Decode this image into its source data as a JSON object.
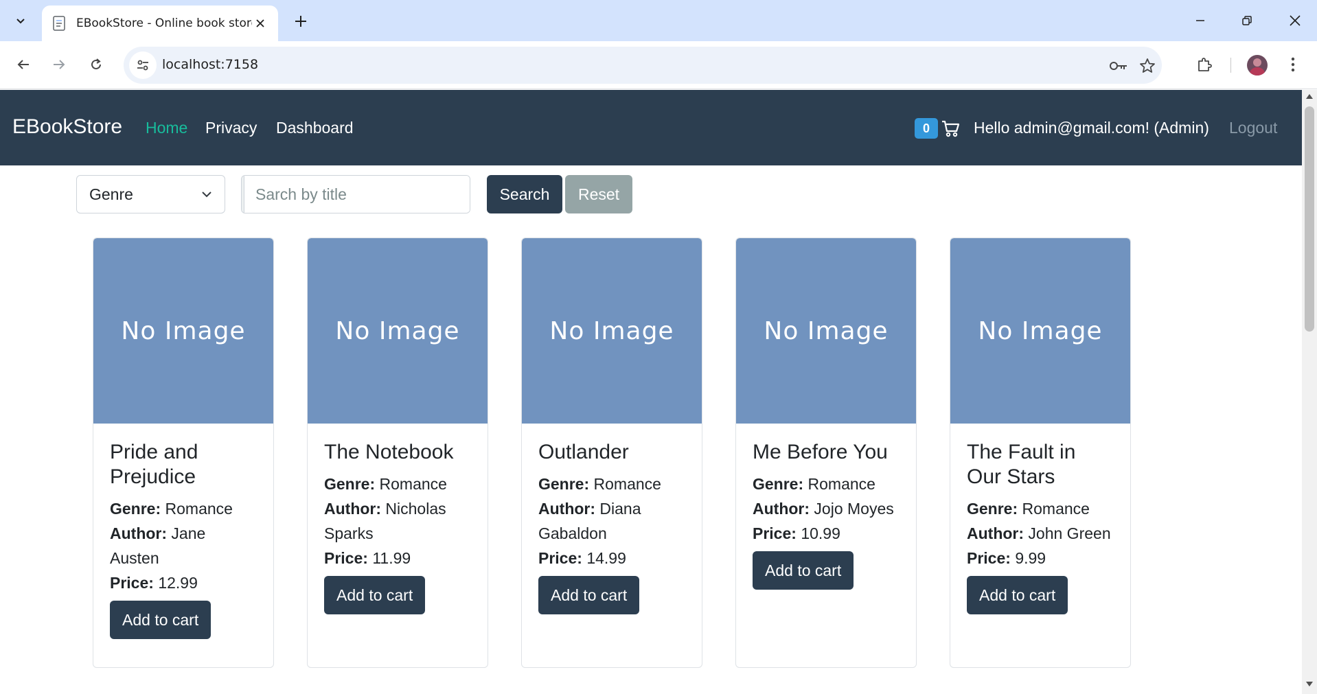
{
  "browser": {
    "tab_title": "EBookStore - Online book store",
    "url": "localhost:7158"
  },
  "navbar": {
    "brand": "EBookStore",
    "links": [
      {
        "label": "Home",
        "active": true
      },
      {
        "label": "Privacy",
        "active": false
      },
      {
        "label": "Dashboard",
        "active": false
      }
    ],
    "cart_count": "0",
    "greeting": "Hello admin@gmail.com! (Admin)",
    "logout": "Logout"
  },
  "filters": {
    "genre_selected": "Genre",
    "search_placeholder": "Sarch by title",
    "search_label": "Search",
    "reset_label": "Reset"
  },
  "books": [
    {
      "title": "Pride and Prejudice",
      "genre": "Romance",
      "author": "Jane Austen",
      "price": "12.99"
    },
    {
      "title": "The Notebook",
      "genre": "Romance",
      "author": "Nicholas Sparks",
      "price": "11.99"
    },
    {
      "title": "Outlander",
      "genre": "Romance",
      "author": "Diana Gabaldon",
      "price": "14.99"
    },
    {
      "title": "Me Before You",
      "genre": "Romance",
      "author": "Jojo Moyes",
      "price": "10.99"
    },
    {
      "title": "The Fault in Our Stars",
      "genre": "Romance",
      "author": "John Green",
      "price": "9.99"
    }
  ],
  "card_labels": {
    "no_image": "No Image",
    "genre": "Genre:",
    "author": "Author:",
    "price": "Price:",
    "add_to_cart": "Add to cart"
  },
  "colors": {
    "navbar_bg": "#2c3e50",
    "active_link": "#18bc9c",
    "badge": "#3498db",
    "reset_button": "#95a5a6",
    "image_placeholder": "#7193bf"
  }
}
